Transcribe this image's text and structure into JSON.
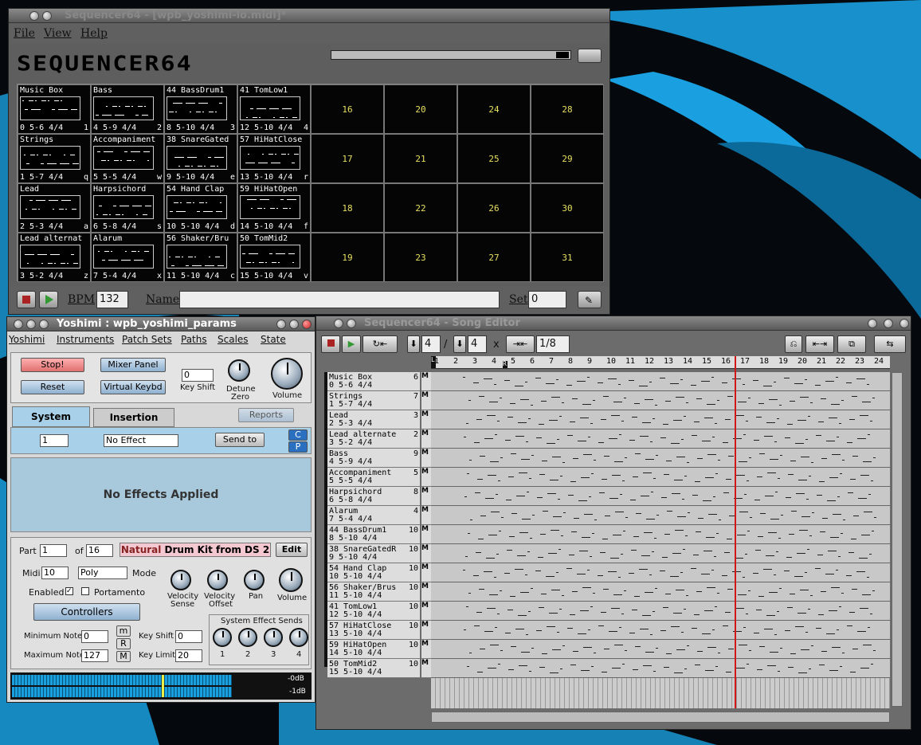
{
  "sequencer": {
    "title": "Sequencer64 - [wpb_yoshimi-lo.midi]*",
    "menu": [
      "File",
      "View",
      "Help"
    ],
    "logo": "SEQUENCER64",
    "slots": [
      {
        "name": "Music Box",
        "foot": "0  5-6 4/4",
        "key": "1"
      },
      {
        "name": "Bass",
        "foot": "4  5-9 4/4",
        "key": "2"
      },
      {
        "name": "44 BassDrum1",
        "foot": "8  5-10 4/4",
        "key": "3"
      },
      {
        "name": "41 TomLow1",
        "foot": "12 5-10 4/4",
        "key": "4"
      },
      {
        "name": "Strings",
        "foot": "1  5-7 4/4",
        "key": "q"
      },
      {
        "name": "Accompaniment",
        "foot": "5  5-5 4/4",
        "key": "w"
      },
      {
        "name": "38 SnareGated",
        "foot": "9  5-10 4/4",
        "key": "e"
      },
      {
        "name": "57 HiHatClose",
        "foot": "13 5-10 4/4",
        "key": "r"
      },
      {
        "name": "Lead",
        "foot": "2  5-3 4/4",
        "key": "a"
      },
      {
        "name": "Harpsichord",
        "foot": "6  5-8 4/4",
        "key": "s"
      },
      {
        "name": "54 Hand Clap",
        "foot": "10 5-10 4/4",
        "key": "d"
      },
      {
        "name": "59 HiHatOpen",
        "foot": "14 5-10 4/4",
        "key": "f"
      },
      {
        "name": "Lead alternat",
        "foot": "3  5-2 4/4",
        "key": "z"
      },
      {
        "name": "Alarum",
        "foot": "7  5-4 4/4",
        "key": "x"
      },
      {
        "name": "56 Shaker/Bru",
        "foot": "11 5-10 4/4",
        "key": "c"
      },
      {
        "name": "50 TomMid2",
        "foot": "15 5-10 4/4",
        "key": "v"
      }
    ],
    "empty_slots": [
      [
        "16",
        "20",
        "24",
        "28"
      ],
      [
        "17",
        "21",
        "25",
        "29"
      ],
      [
        "18",
        "22",
        "26",
        "30"
      ],
      [
        "19",
        "23",
        "27",
        "31"
      ]
    ],
    "bpm_label": "BPM",
    "bpm": "132",
    "name_label": "Name",
    "set_label": "Set",
    "set": "0"
  },
  "yoshimi": {
    "title": "Yoshimi : wpb_yoshimi_params",
    "menu": [
      "Yoshimi",
      "Instruments",
      "Patch Sets",
      "Paths",
      "Scales",
      "State"
    ],
    "stop": "Stop!",
    "reset": "Reset",
    "mixer": "Mixer Panel",
    "keybd": "Virtual Keybd",
    "keyshift_val": "0",
    "keyshift_label": "Key Shift",
    "detune_label": "Detune",
    "zero_label": "Zero",
    "volume_label": "Volume",
    "tab_system": "System Effects",
    "tab_insertion": "Insertion Effects",
    "reports": "Reports",
    "effect_num": "1",
    "effect_type": "No Effect",
    "send_to": "Send to",
    "c": "C",
    "p": "P",
    "no_effects": "No Effects Applied",
    "part_label": "Part",
    "part": "1",
    "of_label": "of",
    "of": "16",
    "instrument_a": "Natural",
    "instrument_b": " Drum Kit from DS 2",
    "edit": "Edit",
    "midi_label": "Midi",
    "midi": "10",
    "mode_val": "Poly",
    "mode_label": "Mode",
    "enabled": "Enabled",
    "portamento": "Portamento",
    "controllers": "Controllers",
    "vel_sense": [
      "Velocity",
      "Sense"
    ],
    "vel_offset": [
      "Velocity",
      "Offset"
    ],
    "pan": "Pan",
    "volume2": "Volume",
    "min_note_label": "Minimum Note",
    "min_note": "0",
    "max_note_label": "Maximum Note",
    "max_note": "127",
    "m": "m",
    "r": "R",
    "M": "M",
    "keyshift2_label": "Key Shift",
    "keyshift2": "0",
    "keylimit_label": "Key Limit",
    "keylimit": "20",
    "sends_label": "System Effect Sends",
    "sends": [
      "1",
      "2",
      "3",
      "4"
    ],
    "db1": "-0dB",
    "db2": "-1dB"
  },
  "song": {
    "title": "Sequencer64 - Song Editor",
    "beats": "4",
    "beat_width": "4",
    "x": "x",
    "snap": "1/8",
    "ruler": [
      "1",
      "2",
      "3",
      "4",
      "5",
      "6",
      "7",
      "8",
      "9",
      "10",
      "11",
      "12",
      "13",
      "14",
      "15",
      "16",
      "17",
      "18",
      "19",
      "20",
      "21",
      "22",
      "23",
      "24"
    ],
    "L": "L",
    "R": "R",
    "tracks": [
      {
        "n": "0",
        "t1": "Music Box",
        "t2": "0  5-6 4/4",
        "ch": "6"
      },
      {
        "n": "",
        "t1": "Strings",
        "t2": "1  5-7 4/4",
        "ch": "7"
      },
      {
        "n": "",
        "t1": "Lead",
        "t2": "2  5-3 4/4",
        "ch": "3"
      },
      {
        "n": "",
        "t1": "Lead alternate",
        "t2": "3  5-2 4/4",
        "ch": "2"
      },
      {
        "n": "",
        "t1": "Bass",
        "t2": "4  5-9 4/4",
        "ch": "9"
      },
      {
        "n": "",
        "t1": "Accompaniment",
        "t2": "5  5-5 4/4",
        "ch": "5"
      },
      {
        "n": "",
        "t1": "Harpsichord",
        "t2": "6  5-8 4/4",
        "ch": "8"
      },
      {
        "n": "",
        "t1": "Alarum",
        "t2": "7  5-4 4/4",
        "ch": "4"
      },
      {
        "n": "",
        "t1": "44 BassDrum1",
        "t2": "8  5-10 4/4",
        "ch": "10"
      },
      {
        "n": "",
        "t1": "38 SnareGatedR",
        "t2": "9  5-10 4/4",
        "ch": "10"
      },
      {
        "n": "",
        "t1": "54 Hand Clap",
        "t2": "10 5-10 4/4",
        "ch": "10"
      },
      {
        "n": "",
        "t1": "56 Shaker/Brus",
        "t2": "11 5-10 4/4",
        "ch": "10"
      },
      {
        "n": "",
        "t1": "41 TomLow1",
        "t2": "12 5-10 4/4",
        "ch": "10"
      },
      {
        "n": "",
        "t1": "57 HiHatClose",
        "t2": "13 5-10 4/4",
        "ch": "10"
      },
      {
        "n": "",
        "t1": "59 HiHatOpen",
        "t2": "14 5-10 4/4",
        "ch": "10"
      },
      {
        "n": "",
        "t1": "50 TomMid2",
        "t2": "15 5-10 4/4",
        "ch": "10"
      }
    ],
    "mute": "M"
  },
  "colors": {
    "accent_blue": "#1aa0e0",
    "playhead": "#d01818",
    "slot_num": "#e8e060"
  }
}
